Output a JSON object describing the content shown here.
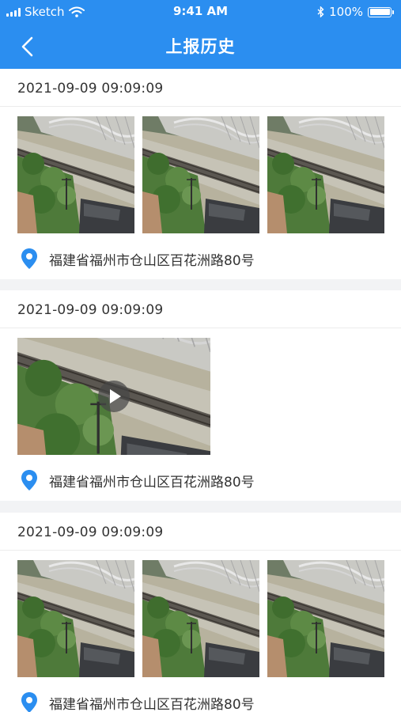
{
  "status_bar": {
    "carrier": "Sketch",
    "time": "9:41 AM",
    "battery": "100%",
    "battery_level": 1.0
  },
  "nav": {
    "title": "上报历史",
    "back_icon": "chevron-left-icon"
  },
  "colors": {
    "header": "#2b8ef0",
    "pin": "#2b8ef0"
  },
  "reports": [
    {
      "time": "2021-09-09 09:09:09",
      "media": "photos",
      "photo_count": 3,
      "location": "福建省福州市仓山区百花洲路80号"
    },
    {
      "time": "2021-09-09 09:09:09",
      "media": "video",
      "photo_count": 0,
      "location": "福建省福州市仓山区百花洲路80号"
    },
    {
      "time": "2021-09-09 09:09:09",
      "media": "photos",
      "photo_count": 3,
      "location": "福建省福州市仓山区百花洲路80号"
    }
  ]
}
